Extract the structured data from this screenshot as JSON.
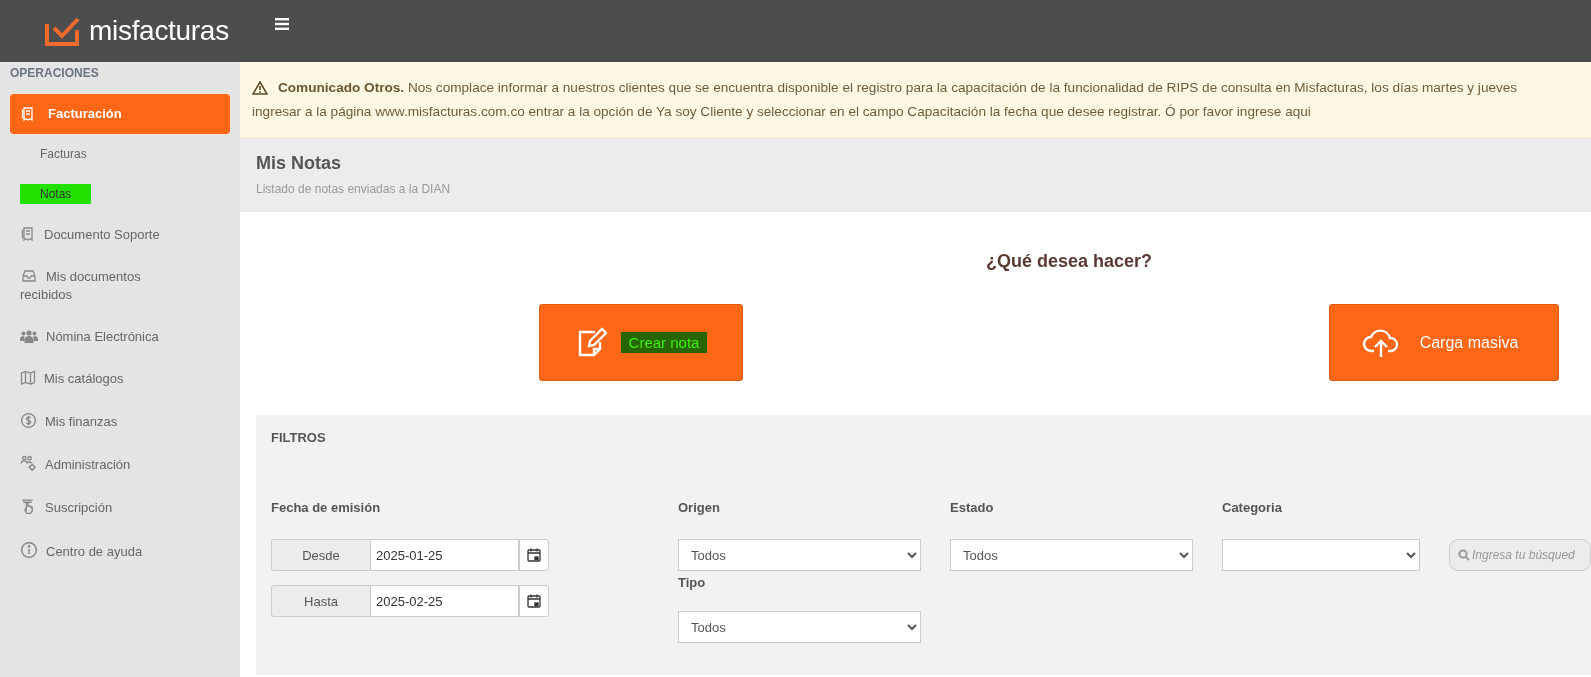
{
  "header": {
    "logo_text": "misfacturas"
  },
  "sidebar": {
    "section_title": "OPERACIONES",
    "items": [
      {
        "label": "Facturación",
        "selected": true,
        "children": [
          {
            "label": "Facturas",
            "selected": false
          },
          {
            "label": "Notas",
            "selected": true
          }
        ]
      },
      {
        "label": "Documento Soporte",
        "selected": false
      },
      {
        "label": "Mis documentos recibidos",
        "selected": false
      },
      {
        "label": "Nómina Electrónica",
        "selected": false
      },
      {
        "label": "Mis catálogos",
        "selected": false
      },
      {
        "label": "Mis finanzas",
        "selected": false
      },
      {
        "label": "Administración",
        "selected": false
      },
      {
        "label": "Suscripción",
        "selected": false
      },
      {
        "label": "Centro de ayuda",
        "selected": false
      }
    ]
  },
  "alert": {
    "lines": [
      "**Comunicado Otros.** Nos complace informar a nuestros clientes que se encuentra disponible el registro para la capacitación de la funcionalidad de RIPS de consulta en Misfacturas, los días martes y jueves",
      "ingresar a la página www.misfacturas.com.co entrar a la opción de Ya soy Cliente y seleccionar en el campo Capacitación la fecha que desee registrar. Ó por favor ingrese aqui"
    ]
  },
  "page_header": {
    "title": "Mis Notas",
    "subtitle": "Listado de notas enviadas a la DIAN"
  },
  "actions": {
    "heading": "¿Qué desea hacer?",
    "buttons": [
      {
        "label": "Crear nota",
        "highlighted": true
      },
      {
        "label": "Carga masiva",
        "highlighted": false
      }
    ]
  },
  "filters": {
    "title": "FILTROS",
    "date": {
      "label": "Fecha de emisión",
      "from_label": "Desde",
      "from_value": "2025-01-25",
      "to_label": "Hasta",
      "to_value": "2025-02-25"
    },
    "origen": {
      "label": "Origen",
      "value": "Todos"
    },
    "tipo": {
      "label": "Tipo",
      "value": "Todos"
    },
    "estado": {
      "label": "Estado",
      "value": "Todos"
    },
    "categoria": {
      "label": "Categoria"
    },
    "search": {
      "placeholder": "Ingresa tu búsqued"
    }
  }
}
